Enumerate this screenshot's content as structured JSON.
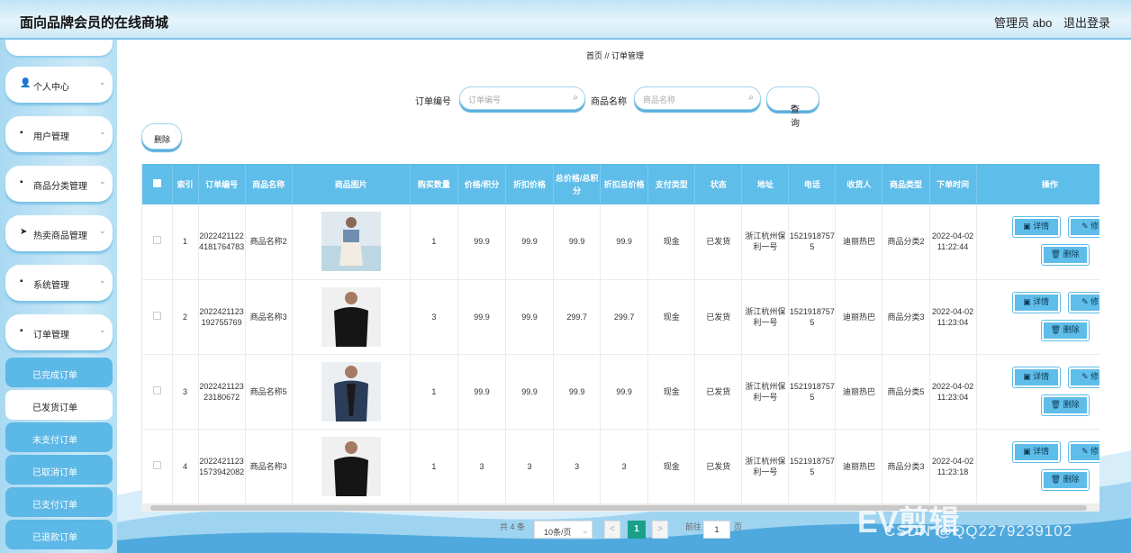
{
  "header": {
    "title": "面向品牌会员的在线商城",
    "user": "管理员 abo",
    "logout": "退出登录"
  },
  "sidebar": {
    "menus": [
      {
        "label": "个人中心",
        "icon": "person-icon",
        "glyph": "👤"
      },
      {
        "label": "用户管理",
        "icon": "grid-icon",
        "glyph": "▪"
      },
      {
        "label": "商品分类管理",
        "icon": "grid-icon",
        "glyph": "▪"
      },
      {
        "label": "热卖商品管理",
        "icon": "send-icon",
        "glyph": "➤"
      },
      {
        "label": "系统管理",
        "icon": "grid-icon",
        "glyph": "▪"
      },
      {
        "label": "订单管理",
        "icon": "grid-icon",
        "glyph": "▪"
      }
    ],
    "submenu": [
      {
        "label": "已完成订单",
        "active": false
      },
      {
        "label": "已发货订单",
        "active": true
      },
      {
        "label": "未支付订单",
        "active": false
      },
      {
        "label": "已取消订单",
        "active": false
      },
      {
        "label": "已支付订单",
        "active": false
      },
      {
        "label": "已退款订单",
        "active": false
      }
    ]
  },
  "breadcrumb": "首页 // 订单管理",
  "search": {
    "order_label": "订单编号",
    "order_placeholder": "订单编号",
    "product_label": "商品名称",
    "product_placeholder": "商品名称",
    "query_button": "查询"
  },
  "delete_button": "删除",
  "table": {
    "headers": [
      "索引",
      "订单编号",
      "商品名称",
      "商品图片",
      "购买数量",
      "价格/积分",
      "折扣价格",
      "总价格/总积分",
      "折扣总价格",
      "支付类型",
      "状态",
      "地址",
      "电话",
      "收货人",
      "商品类型",
      "下单时间",
      "操作"
    ],
    "rows": [
      {
        "idx": "1",
        "order": "20224211224181764783",
        "name": "商品名称2",
        "qty": "1",
        "price": "99.9",
        "disc": "99.9",
        "total": "99.9",
        "disc_total": "99.9",
        "pay": "现金",
        "status": "已发货",
        "addr": "浙江杭州保利一号",
        "phone": "15219187575",
        "receiver": "迪丽热巴",
        "type": "商品分类2",
        "time": "2022-04-02 11:22:44"
      },
      {
        "idx": "2",
        "order": "2022421123192755769",
        "name": "商品名称3",
        "qty": "3",
        "price": "99.9",
        "disc": "99.9",
        "total": "299.7",
        "disc_total": "299.7",
        "pay": "现金",
        "status": "已发货",
        "addr": "浙江杭州保利一号",
        "phone": "15219187575",
        "receiver": "迪丽热巴",
        "type": "商品分类3",
        "time": "2022-04-02 11:23:04"
      },
      {
        "idx": "3",
        "order": "2022421123231806​72",
        "name": "商品名称5",
        "qty": "1",
        "price": "99.9",
        "disc": "99.9",
        "total": "99.9",
        "disc_total": "99.9",
        "pay": "现金",
        "status": "已发货",
        "addr": "浙江杭州保利一号",
        "phone": "15219187575",
        "receiver": "迪丽热巴",
        "type": "商品分类5",
        "time": "2022-04-02 11:23:04"
      },
      {
        "idx": "4",
        "order": "20224211231573942082",
        "name": "商品名称3",
        "qty": "1",
        "price": "3",
        "disc": "3",
        "total": "3",
        "disc_total": "3",
        "pay": "现金",
        "status": "已发货",
        "addr": "浙江杭州保利一号",
        "phone": "15219187575",
        "receiver": "迪丽热巴",
        "type": "商品分类3",
        "time": "2022-04-02 11:23:18"
      }
    ],
    "actions": {
      "detail": "详情",
      "edit": "修",
      "delete": "删除"
    }
  },
  "pagination": {
    "total": "共 4 条",
    "page_size": "10条/页",
    "prev": "<",
    "current": "1",
    "next": ">",
    "goto_label": "前往",
    "goto_value": "1",
    "page_unit": "页"
  },
  "watermark": {
    "csdn": "CSDN @QQ2279239102",
    "ev": "EV剪辑"
  }
}
